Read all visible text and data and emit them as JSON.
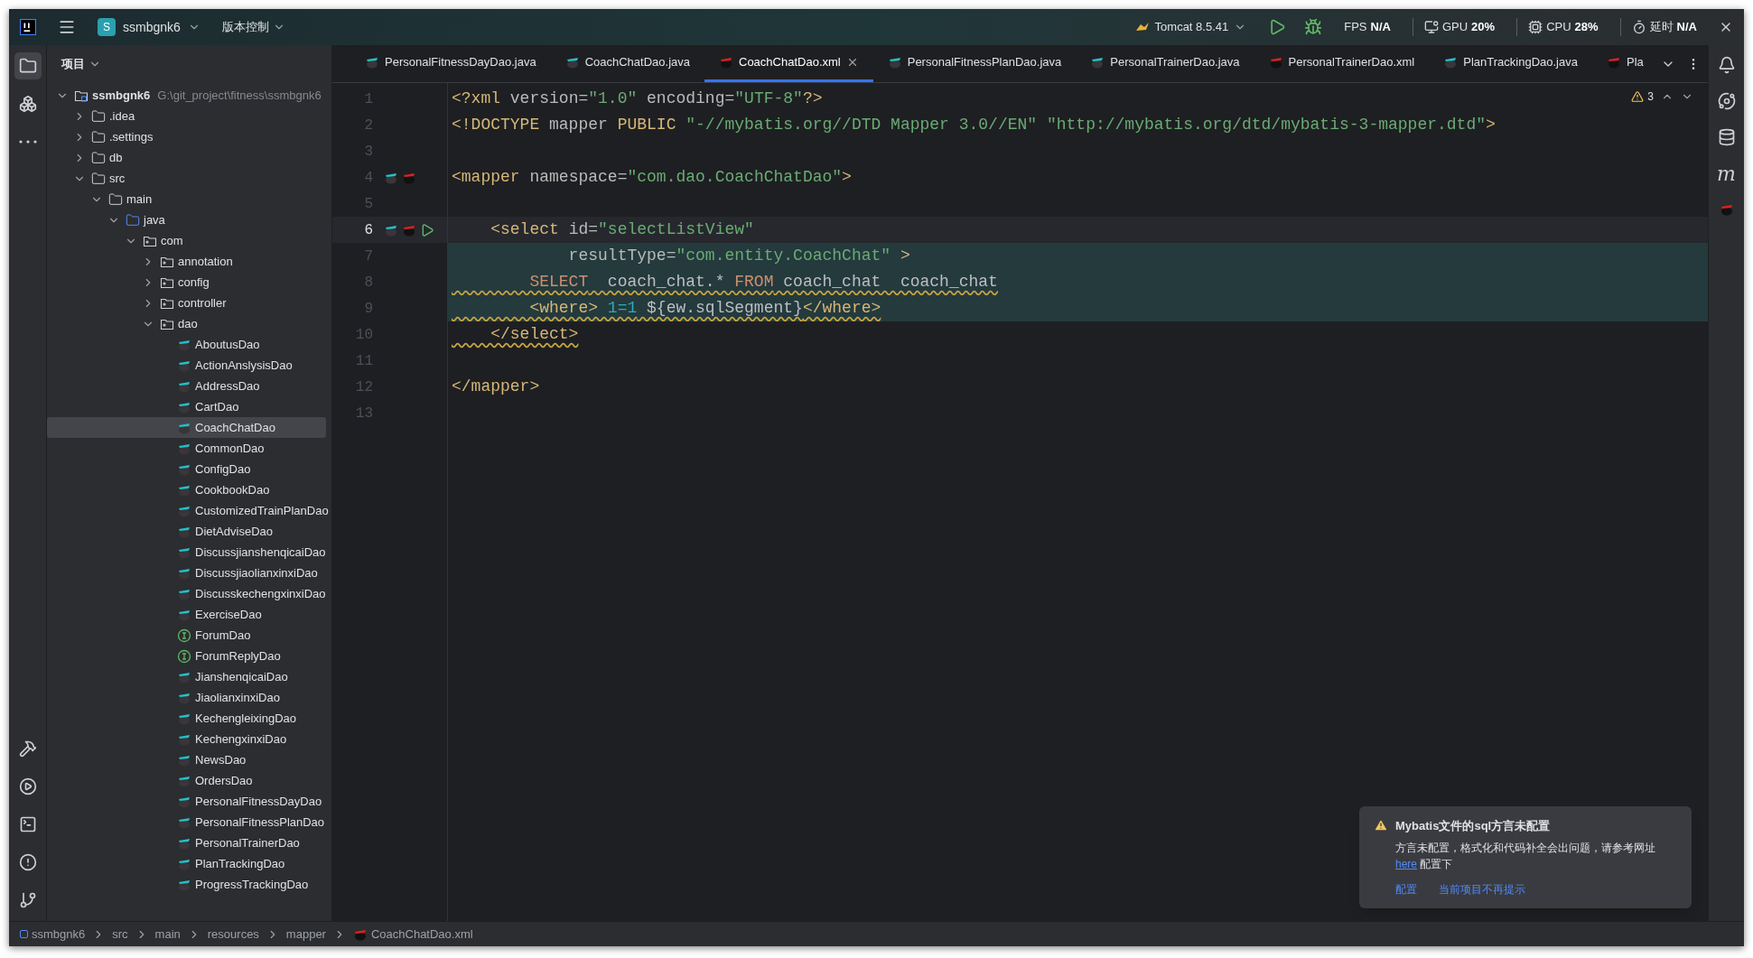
{
  "title_bar": {
    "project_badge": "S",
    "project": "ssmbgnk6",
    "vcs": "版本控制",
    "run_config": "Tomcat 8.5.41",
    "monitors": [
      {
        "kind": "fps",
        "label": "FPS",
        "value": "N/A"
      },
      {
        "kind": "gpu",
        "label": "GPU",
        "value": "20%"
      },
      {
        "kind": "cpu",
        "label": "CPU",
        "value": "28%"
      },
      {
        "kind": "latency",
        "label": "延时",
        "value": "N/A"
      }
    ]
  },
  "left_toolbar": {
    "top": [
      {
        "kind": "project",
        "selected": true
      },
      {
        "kind": "structure",
        "selected": false
      },
      {
        "kind": "more",
        "selected": false
      }
    ],
    "bottom": [
      {
        "kind": "build"
      },
      {
        "kind": "services"
      },
      {
        "kind": "terminal"
      },
      {
        "kind": "problems"
      },
      {
        "kind": "git"
      }
    ]
  },
  "project_panel": {
    "title": "项目",
    "tree": [
      {
        "label": "ssmbgnk6",
        "path": "G:\\git_project\\fitness\\ssmbgnk6",
        "kind": "module",
        "expanded": true,
        "selected": false,
        "children": [
          {
            "label": ".idea",
            "kind": "folder",
            "expanded": false,
            "selected": false
          },
          {
            "label": ".settings",
            "kind": "folder",
            "expanded": false,
            "selected": false
          },
          {
            "label": "db",
            "kind": "folder",
            "expanded": false,
            "selected": false
          },
          {
            "label": "src",
            "kind": "folder",
            "expanded": true,
            "selected": false,
            "children": [
              {
                "label": "main",
                "kind": "folder",
                "expanded": true,
                "selected": false,
                "children": [
                  {
                    "label": "java",
                    "kind": "source",
                    "expanded": true,
                    "selected": false,
                    "children": [
                      {
                        "label": "com",
                        "kind": "package",
                        "expanded": true,
                        "selected": false,
                        "children": [
                          {
                            "label": "annotation",
                            "kind": "package",
                            "expanded": false,
                            "selected": false
                          },
                          {
                            "label": "config",
                            "kind": "package",
                            "expanded": false,
                            "selected": false
                          },
                          {
                            "label": "controller",
                            "kind": "package",
                            "expanded": false,
                            "selected": false
                          },
                          {
                            "label": "dao",
                            "kind": "package",
                            "expanded": true,
                            "selected": false,
                            "children": [
                              {
                                "label": "AboutusDao",
                                "kind": "mapper",
                                "selected": false
                              },
                              {
                                "label": "ActionAnslysisDao",
                                "kind": "mapper",
                                "selected": false
                              },
                              {
                                "label": "AddressDao",
                                "kind": "mapper",
                                "selected": false
                              },
                              {
                                "label": "CartDao",
                                "kind": "mapper",
                                "selected": false
                              },
                              {
                                "label": "CoachChatDao",
                                "kind": "mapper",
                                "selected": true
                              },
                              {
                                "label": "CommonDao",
                                "kind": "mapper",
                                "selected": false
                              },
                              {
                                "label": "ConfigDao",
                                "kind": "mapper",
                                "selected": false
                              },
                              {
                                "label": "CookbookDao",
                                "kind": "mapper",
                                "selected": false
                              },
                              {
                                "label": "CustomizedTrainPlanDao",
                                "kind": "mapper",
                                "selected": false
                              },
                              {
                                "label": "DietAdviseDao",
                                "kind": "mapper",
                                "selected": false
                              },
                              {
                                "label": "DiscussjianshenqicaiDao",
                                "kind": "mapper",
                                "selected": false
                              },
                              {
                                "label": "DiscussjiaolianxinxiDao",
                                "kind": "mapper",
                                "selected": false
                              },
                              {
                                "label": "DiscusskechengxinxiDao",
                                "kind": "mapper",
                                "selected": false
                              },
                              {
                                "label": "ExerciseDao",
                                "kind": "mapper",
                                "selected": false
                              },
                              {
                                "label": "ForumDao",
                                "kind": "interface",
                                "selected": false
                              },
                              {
                                "label": "ForumReplyDao",
                                "kind": "interface",
                                "selected": false
                              },
                              {
                                "label": "JianshenqicaiDao",
                                "kind": "mapper",
                                "selected": false
                              },
                              {
                                "label": "JiaolianxinxiDao",
                                "kind": "mapper",
                                "selected": false
                              },
                              {
                                "label": "KechengleixingDao",
                                "kind": "mapper",
                                "selected": false
                              },
                              {
                                "label": "KechengxinxiDao",
                                "kind": "mapper",
                                "selected": false
                              },
                              {
                                "label": "NewsDao",
                                "kind": "mapper",
                                "selected": false
                              },
                              {
                                "label": "OrdersDao",
                                "kind": "mapper",
                                "selected": false
                              },
                              {
                                "label": "PersonalFitnessDayDao",
                                "kind": "mapper",
                                "selected": false
                              },
                              {
                                "label": "PersonalFitnessPlanDao",
                                "kind": "mapper",
                                "selected": false
                              },
                              {
                                "label": "PersonalTrainerDao",
                                "kind": "mapper",
                                "selected": false
                              },
                              {
                                "label": "PlanTrackingDao",
                                "kind": "mapper",
                                "selected": false
                              },
                              {
                                "label": "ProgressTrackingDao",
                                "kind": "mapper",
                                "selected": false
                              }
                            ]
                          }
                        ]
                      }
                    ]
                  }
                ]
              }
            ]
          }
        ]
      }
    ]
  },
  "tabs": [
    {
      "label": "PersonalFitnessDayDao.java",
      "kind": "java",
      "selected": false
    },
    {
      "label": "CoachChatDao.java",
      "kind": "java",
      "selected": false
    },
    {
      "label": "CoachChatDao.xml",
      "kind": "xml",
      "selected": true
    },
    {
      "label": "PersonalFitnessPlanDao.java",
      "kind": "java",
      "selected": false
    },
    {
      "label": "PersonalTrainerDao.java",
      "kind": "java",
      "selected": false
    },
    {
      "label": "PersonalTrainerDao.xml",
      "kind": "xml",
      "selected": false
    },
    {
      "label": "PlanTrackingDao.java",
      "kind": "java",
      "selected": false
    },
    {
      "label": "Pla",
      "kind": "xml",
      "selected": false
    }
  ],
  "editor": {
    "warning_count": "3",
    "lines": [
      {
        "number": "1",
        "current": false,
        "injected": false,
        "warning": false,
        "tokens": [
          {
            "kind": "tag",
            "text": "<?xml"
          },
          {
            "kind": "attr",
            "text": " version="
          },
          {
            "kind": "string",
            "text": "\"1.0\""
          },
          {
            "kind": "attr",
            "text": " encoding="
          },
          {
            "kind": "string",
            "text": "\"UTF-8\""
          },
          {
            "kind": "tag",
            "text": "?>"
          }
        ]
      },
      {
        "number": "2",
        "current": false,
        "injected": false,
        "warning": false,
        "tokens": [
          {
            "kind": "tag",
            "text": "<!DOCTYPE"
          },
          {
            "kind": "attr",
            "text": " mapper "
          },
          {
            "kind": "tag",
            "text": "PUBLIC"
          },
          {
            "kind": "string",
            "text": " \"-//mybatis.org//DTD Mapper 3.0//EN\" \"http://mybatis.org/dtd/mybatis-3-mapper.dtd\""
          },
          {
            "kind": "tag",
            "text": ">"
          }
        ]
      },
      {
        "number": "3",
        "current": false
      },
      {
        "number": "4",
        "current": false,
        "injected": false,
        "warning": false,
        "gutter": [
          {
            "kind": "java-mapper"
          },
          {
            "kind": "xml-mapper"
          }
        ],
        "tokens": [
          {
            "kind": "tag",
            "text": "<mapper"
          },
          {
            "kind": "attr",
            "text": " namespace="
          },
          {
            "kind": "string",
            "text": "\"com.dao.CoachChatDao\""
          },
          {
            "kind": "tag",
            "text": ">"
          }
        ]
      },
      {
        "number": "5",
        "current": false
      },
      {
        "number": "6",
        "current": true,
        "injected": false,
        "warning": false,
        "gutter": [
          {
            "kind": "java-mapper"
          },
          {
            "kind": "xml-mapper"
          },
          {
            "kind": "run"
          }
        ],
        "tokens": [
          {
            "kind": "tag",
            "text": "    <select"
          },
          {
            "kind": "attr",
            "text": " id="
          },
          {
            "kind": "string",
            "text": "\"selectListView\""
          }
        ]
      },
      {
        "number": "7",
        "current": false,
        "injected": true,
        "warning": false,
        "tokens": [
          {
            "kind": "attr",
            "text": "            resultType="
          },
          {
            "kind": "string",
            "text": "\"com.entity.CoachChat\""
          },
          {
            "kind": "tag",
            "text": " >"
          }
        ]
      },
      {
        "number": "8",
        "current": false,
        "injected": true,
        "warning": true,
        "tokens": [
          {
            "kind": "keyword",
            "text": "        SELECT"
          },
          {
            "kind": "plain",
            "text": "  coach_chat.* "
          },
          {
            "kind": "keyword",
            "text": "FROM"
          },
          {
            "kind": "plain",
            "text": " coach_chat  coach_chat"
          }
        ]
      },
      {
        "number": "9",
        "current": false,
        "injected": true,
        "warning": true,
        "tokens": [
          {
            "kind": "tag",
            "text": "        <where>"
          },
          {
            "kind": "number",
            "text": " 1=1"
          },
          {
            "kind": "plain",
            "text": " ${ew.sqlSegment}"
          },
          {
            "kind": "tag",
            "text": "</where>"
          }
        ]
      },
      {
        "number": "10",
        "current": false,
        "injected": false,
        "warning": true,
        "tokens": [
          {
            "kind": "tag",
            "text": "    </select>"
          }
        ]
      },
      {
        "number": "11",
        "current": false
      },
      {
        "number": "12",
        "current": false,
        "injected": false,
        "warning": false,
        "tokens": [
          {
            "kind": "tag",
            "text": "</mapper>"
          }
        ]
      },
      {
        "number": "13",
        "current": false
      }
    ]
  },
  "right_toolbar": [
    {
      "kind": "notifications"
    },
    {
      "kind": "ai"
    },
    {
      "kind": "database"
    },
    {
      "kind": "maven",
      "glyph": "m"
    },
    {
      "kind": "mybatis"
    }
  ],
  "notification": {
    "title": "Mybatis文件的sql方言未配置",
    "body_before": "方言未配置，格式化和代码补全会出问题，请参考网址",
    "link": "here",
    "body_after": " 配置下",
    "actions": [
      "配置",
      "当前项目不再提示"
    ]
  },
  "status_bar": {
    "breadcrumbs": [
      {
        "label": "ssmbgnk6",
        "kind": "module"
      },
      {
        "label": "src",
        "kind": "folder"
      },
      {
        "label": "main",
        "kind": "folder"
      },
      {
        "label": "resources",
        "kind": "folder"
      },
      {
        "label": "mapper",
        "kind": "folder"
      },
      {
        "label": "CoachChatDao.xml",
        "kind": "xml"
      }
    ]
  }
}
